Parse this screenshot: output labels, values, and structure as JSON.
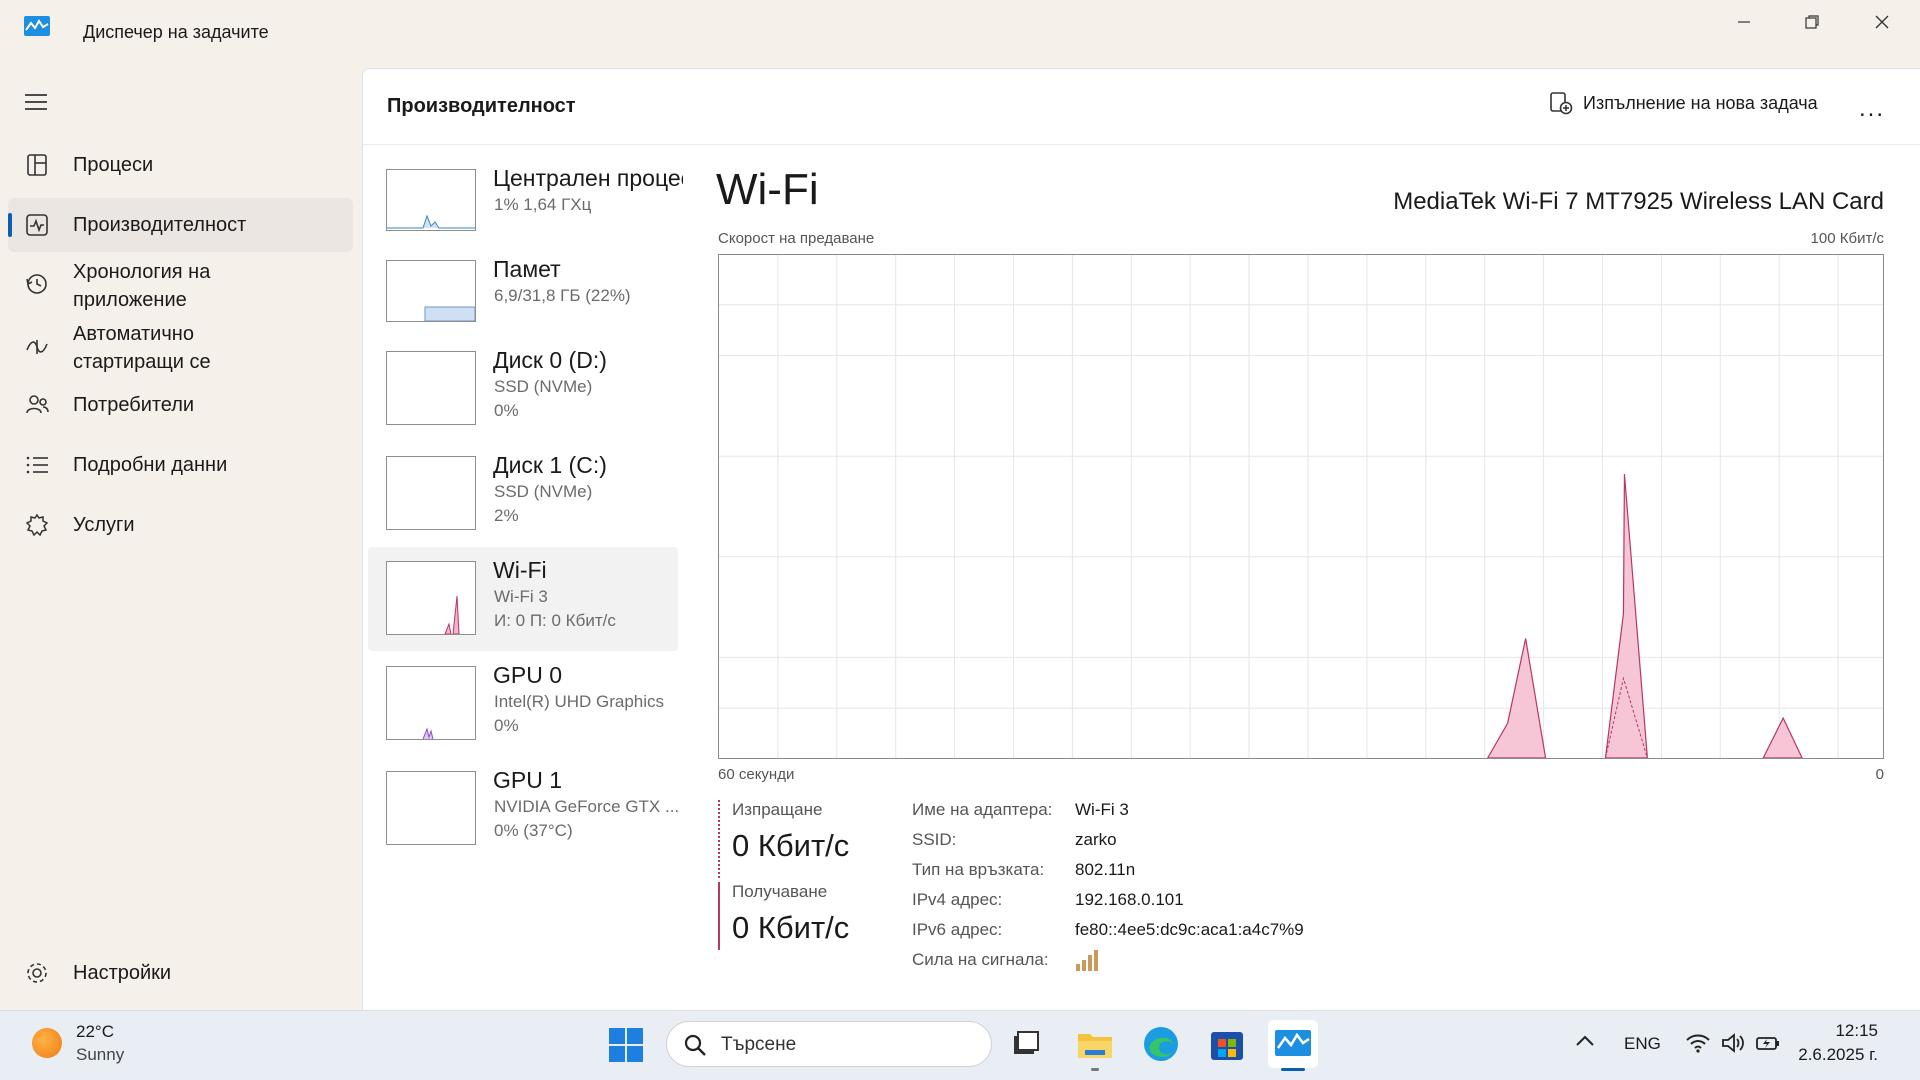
{
  "window": {
    "title": "Диспечер на задачите"
  },
  "sidebar": {
    "items": [
      {
        "label": "Процеси",
        "icon": "processes-icon"
      },
      {
        "label": "Производителност",
        "icon": "performance-icon",
        "active": true
      },
      {
        "label": "Хронология на приложение",
        "icon": "history-icon"
      },
      {
        "label": "Автоматично стартиращи се",
        "icon": "startup-icon"
      },
      {
        "label": "Потребители",
        "icon": "users-icon"
      },
      {
        "label": "Подробни данни",
        "icon": "details-icon"
      },
      {
        "label": "Услуги",
        "icon": "services-icon"
      }
    ],
    "settings_label": "Настройки"
  },
  "header": {
    "title": "Производителност",
    "run_task_label": "Изпълнение на нова задача",
    "more_label": "..."
  },
  "devices": [
    {
      "name": "Централен процесор",
      "sub1": "1%  1,64 ГХц",
      "sub2": ""
    },
    {
      "name": "Памет",
      "sub1": "6,9/31,8 ГБ (22%)",
      "sub2": ""
    },
    {
      "name": "Диск 0 (D:)",
      "sub1": "SSD (NVMe)",
      "sub2": "0%"
    },
    {
      "name": "Диск 1 (C:)",
      "sub1": "SSD (NVMe)",
      "sub2": "2%"
    },
    {
      "name": "Wi-Fi",
      "sub1": "Wi-Fi 3",
      "sub2": "И: 0  П: 0 Кбит/с",
      "active": true
    },
    {
      "name": "GPU 0",
      "sub1": "Intel(R) UHD Graphics",
      "sub2": "0%"
    },
    {
      "name": "GPU 1",
      "sub1": "NVIDIA GeForce GTX ...",
      "sub2": "0%  (37°C)"
    }
  ],
  "detail": {
    "title": "Wi-Fi",
    "adapter": "MediaTek Wi-Fi 7 MT7925 Wireless LAN Card",
    "graph_label_left": "Скорост на предаване",
    "graph_label_right": "100 Кбит/с",
    "axis_left": "60 секунди",
    "axis_right": "0",
    "send_label": "Изпращане",
    "send_value": "0 Кбит/с",
    "recv_label": "Получаване",
    "recv_value": "0 Кбит/с",
    "props": [
      {
        "k": "Име на адаптера:",
        "v": "Wi-Fi 3"
      },
      {
        "k": "SSID:",
        "v": "zarko"
      },
      {
        "k": "Тип на връзката:",
        "v": "802.11n"
      },
      {
        "k": "IPv4 адрес:",
        "v": "192.168.0.101"
      },
      {
        "k": "IPv6 адрес:",
        "v": "fe80::4ee5:dc9c:aca1:a4c7%9"
      },
      {
        "k": "Сила на сигнала:",
        "v": ""
      }
    ],
    "signal_bars": 4,
    "colors": {
      "accent": "#b8375e",
      "fill": "#f7c6d6"
    }
  },
  "taskbar": {
    "weather_temp": "22°C",
    "weather_desc": "Sunny",
    "search_placeholder": "Търсене",
    "lang": "ENG",
    "time": "12:15",
    "date": "2.6.2025 г."
  }
}
